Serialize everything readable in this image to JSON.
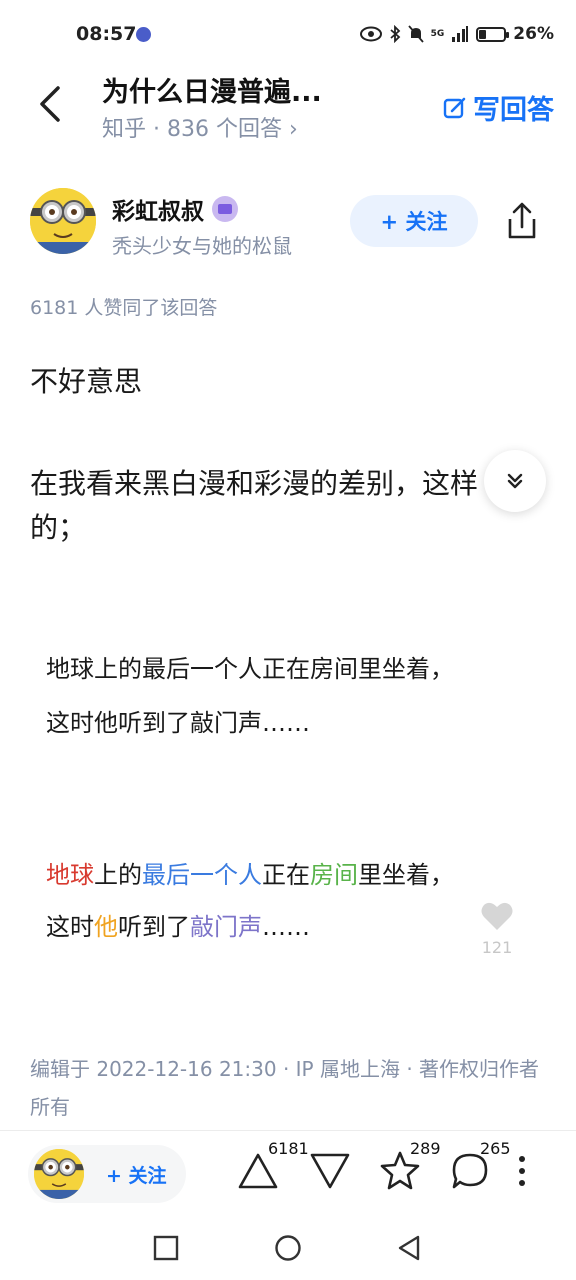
{
  "status_bar": {
    "time": "08:57",
    "network": "5G",
    "battery": "26%",
    "battery_level": 0.26
  },
  "header": {
    "title": "为什么日漫普遍...",
    "subtitle": "知乎 · 836 个回答 ›",
    "write_answer": "写回答"
  },
  "author": {
    "name": "彩虹叔叔",
    "bio": "秃头少女与她的松鼠",
    "follow_label": "+ 关注"
  },
  "answer": {
    "approval": "6181 人赞同了该回答",
    "paragraph1": "不好意思",
    "paragraph2": "在我看来黑白漫和彩漫的差别，这样的；"
  },
  "embed": {
    "plain_line1": "地球上的最后一个人正在房间里坐着，",
    "plain_line2": "这时他听到了敲门声……",
    "color_line1": [
      "地球",
      "上的",
      "最后一个人",
      "正在",
      "房间",
      "里坐着，"
    ],
    "color_line2": [
      "这时",
      "他",
      "听到了",
      "敲门声",
      "……"
    ],
    "colors": {
      "red": "#d83a2f",
      "blue": "#3a7be0",
      "green": "#59b34a",
      "orange": "#f0a320",
      "purple": "#7d74c9"
    },
    "like_count": "121"
  },
  "meta": {
    "edit_info": "编辑于 2022-12-16 21:30 · IP 属地上海 · 著作权归作者所有"
  },
  "action_bar": {
    "follow_label": "+ 关注",
    "upvote_count": "6181",
    "favorite_count": "289",
    "comment_count": "265"
  },
  "accent_color": "#1772f6"
}
